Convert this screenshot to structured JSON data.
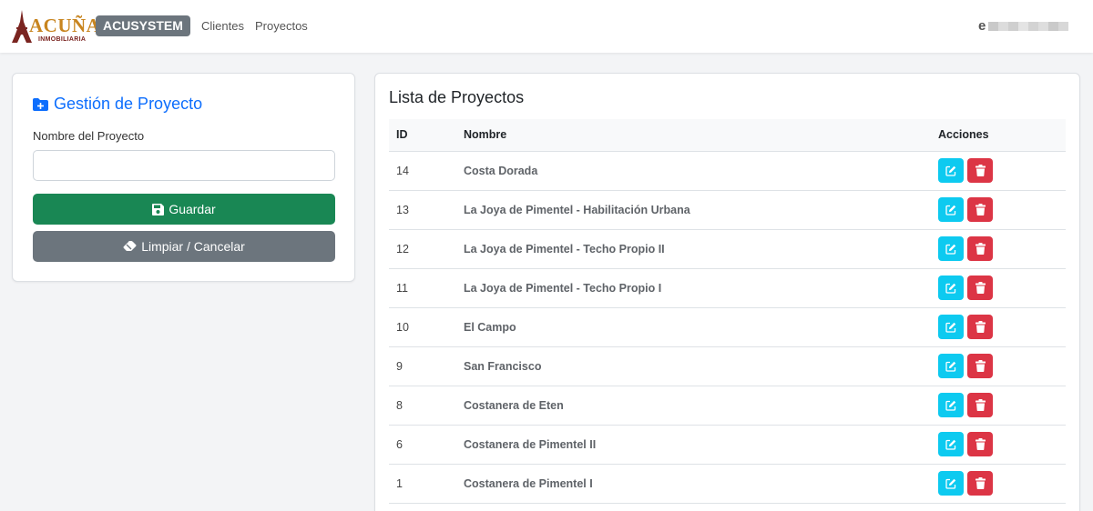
{
  "navbar": {
    "logo_word": "ACUÑA",
    "logo_sub": "INMOBILIARIA",
    "brand": "ACUSYSTEM",
    "links": [
      "Clientes",
      "Proyectos"
    ],
    "user_initial": "e"
  },
  "form": {
    "title": "Gestión de Proyecto",
    "label": "Nombre del Proyecto",
    "input_value": "",
    "save_label": "Guardar",
    "clear_label": "Limpiar / Cancelar"
  },
  "list": {
    "title": "Lista de Proyectos",
    "columns": [
      "ID",
      "Nombre",
      "Acciones"
    ],
    "rows": [
      {
        "id": "14",
        "name": "Costa Dorada"
      },
      {
        "id": "13",
        "name": "La Joya de Pimentel - Habilitación Urbana"
      },
      {
        "id": "12",
        "name": "La Joya de Pimentel - Techo Propio II"
      },
      {
        "id": "11",
        "name": "La Joya de Pimentel - Techo Propio I"
      },
      {
        "id": "10",
        "name": "El Campo"
      },
      {
        "id": "9",
        "name": "San Francisco"
      },
      {
        "id": "8",
        "name": "Costanera de Eten"
      },
      {
        "id": "6",
        "name": "Costanera de Pimentel II"
      },
      {
        "id": "1",
        "name": "Costanera de Pimentel I"
      }
    ]
  },
  "icons": {
    "folder": "folder-plus-icon",
    "save": "floppy-disk-icon",
    "clear": "eraser-icon",
    "edit": "pencil-square-icon",
    "delete": "trash-icon"
  },
  "colors": {
    "primary": "#0d6efd",
    "success": "#198754",
    "secondary": "#6c757d",
    "info": "#0dcaf0",
    "danger": "#dc3545"
  }
}
